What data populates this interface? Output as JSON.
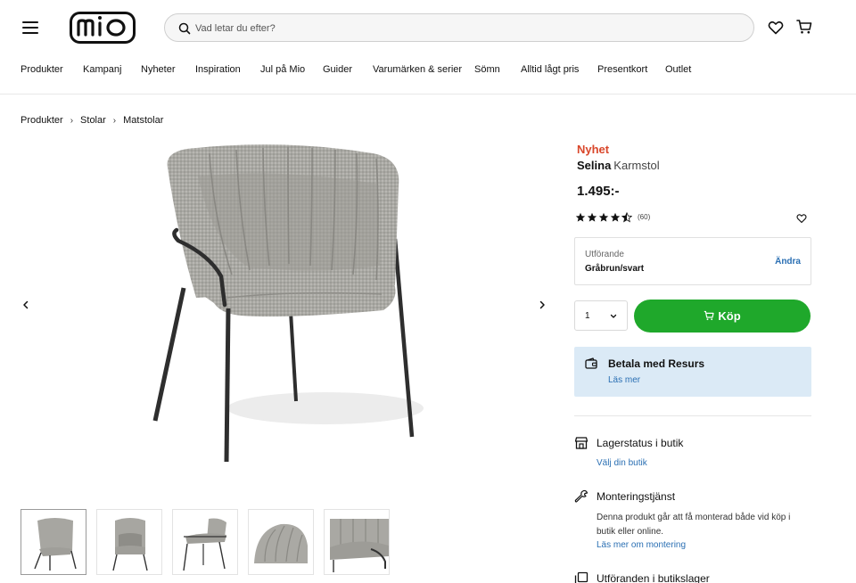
{
  "header": {
    "search_placeholder": "Vad letar du efter?"
  },
  "nav": {
    "items": [
      "Produkter",
      "Kampanj",
      "Nyheter",
      "Inspiration",
      "Jul på Mio",
      "Guider",
      "Varumärken & serier",
      "Sömn",
      "Alltid lågt pris",
      "Presentkort",
      "Outlet"
    ]
  },
  "breadcrumb": [
    "Produkter",
    "Stolar",
    "Matstolar"
  ],
  "product": {
    "badge": "Nyhet",
    "name": "Selina",
    "type": "Karmstol",
    "price": "1.495:-",
    "rating": 4.5,
    "review_count": "(60)",
    "variant_label": "Utförande",
    "variant_value": "Gråbrun/svart",
    "variant_change": "Ändra",
    "quantity": "1",
    "buy_label": "Köp"
  },
  "resurs": {
    "title": "Betala med Resurs",
    "link": "Läs mer"
  },
  "info": {
    "stock_title": "Lagerstatus i butik",
    "stock_link": "Välj din butik",
    "assembly_title": "Monteringstjänst",
    "assembly_desc": "Denna produkt går att få monterad både vid köp i butik eller online.",
    "assembly_link": "Läs mer om montering",
    "variants_title": "Utföranden i butikslager"
  },
  "colors": {
    "accent_green": "#1fa82b",
    "badge_red": "#d9472b",
    "link_blue": "#2a6fb3",
    "resurs_bg": "#dbeaf6"
  }
}
